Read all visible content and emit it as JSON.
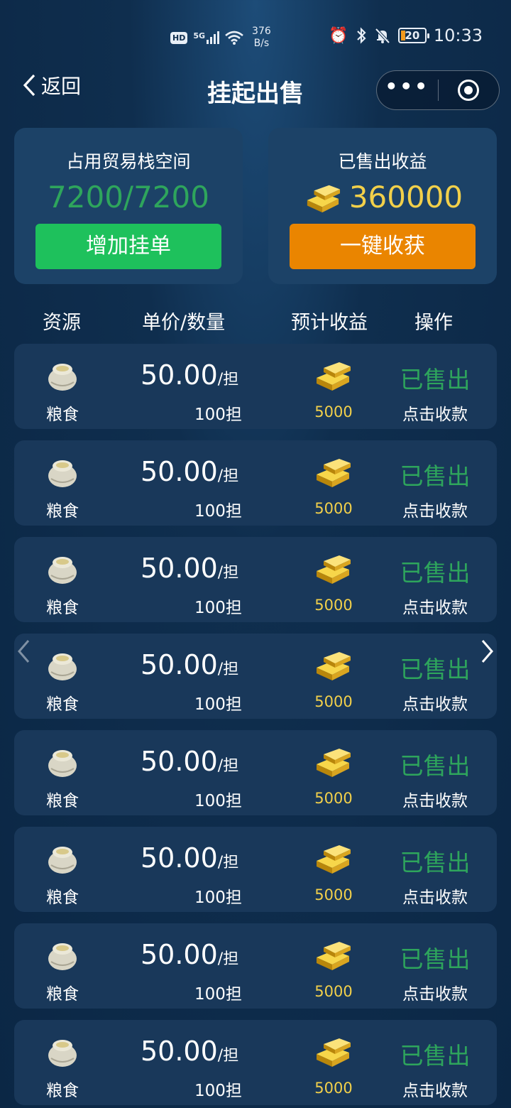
{
  "status_bar": {
    "hd": "HD",
    "signal": "5G",
    "speed_value": "376",
    "speed_unit": "B/s",
    "battery": "20",
    "time": "10:33"
  },
  "nav": {
    "back_label": "返回",
    "title": "挂起出售"
  },
  "space_card": {
    "title": "占用贸易栈空间",
    "value": "7200/7200",
    "button": "增加挂单"
  },
  "earnings_card": {
    "title": "已售出收益",
    "value": "360000",
    "button": "一键收获"
  },
  "table_header": {
    "resource": "资源",
    "price_qty": "单价/数量",
    "earnings": "预计收益",
    "action": "操作"
  },
  "rows": [
    {
      "resource": "粮食",
      "price": "50.00",
      "unit": "/担",
      "qty": "100担",
      "earn": "5000",
      "status": "已售出",
      "action": "点击收款"
    },
    {
      "resource": "粮食",
      "price": "50.00",
      "unit": "/担",
      "qty": "100担",
      "earn": "5000",
      "status": "已售出",
      "action": "点击收款"
    },
    {
      "resource": "粮食",
      "price": "50.00",
      "unit": "/担",
      "qty": "100担",
      "earn": "5000",
      "status": "已售出",
      "action": "点击收款"
    },
    {
      "resource": "粮食",
      "price": "50.00",
      "unit": "/担",
      "qty": "100担",
      "earn": "5000",
      "status": "已售出",
      "action": "点击收款"
    },
    {
      "resource": "粮食",
      "price": "50.00",
      "unit": "/担",
      "qty": "100担",
      "earn": "5000",
      "status": "已售出",
      "action": "点击收款"
    },
    {
      "resource": "粮食",
      "price": "50.00",
      "unit": "/担",
      "qty": "100担",
      "earn": "5000",
      "status": "已售出",
      "action": "点击收款"
    },
    {
      "resource": "粮食",
      "price": "50.00",
      "unit": "/担",
      "qty": "100担",
      "earn": "5000",
      "status": "已售出",
      "action": "点击收款"
    },
    {
      "resource": "粮食",
      "price": "50.00",
      "unit": "/担",
      "qty": "100担",
      "earn": "5000",
      "status": "已售出",
      "action": "点击收款"
    }
  ],
  "colors": {
    "accent_green": "#1ec15c",
    "accent_orange": "#ea8500",
    "gold_text": "#f2d04a",
    "sold_green": "#2ea55c"
  }
}
